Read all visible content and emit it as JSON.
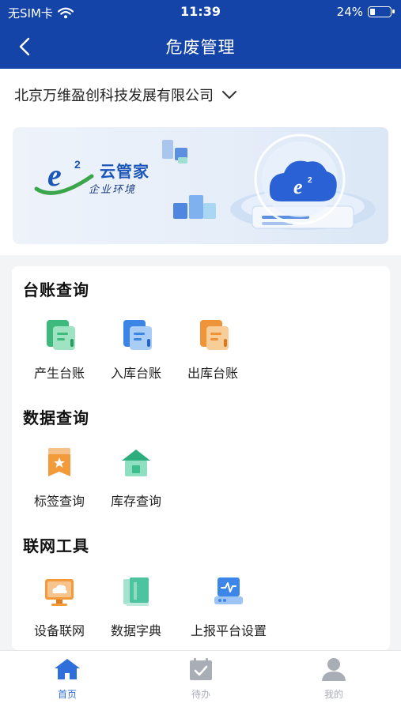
{
  "status_bar": {
    "carrier": "无SIM卡",
    "time": "11:39",
    "battery_percent_label": "24%",
    "battery_level": 0.24,
    "icons": [
      "wifi-icon",
      "battery-icon"
    ]
  },
  "nav": {
    "back_icon": "chevron-left-icon",
    "title": "危废管理"
  },
  "company": {
    "name": "北京万维盈创科技发展有限公司",
    "dropdown_icon": "chevron-down-icon"
  },
  "banner": {
    "logo_letter": "e",
    "logo_sup": "2",
    "brand": "云管家",
    "subtitle": "企业环境"
  },
  "sections": [
    {
      "title": "台账查询",
      "items": [
        {
          "label": "产生台账",
          "icon": "document-icon",
          "color": "#3dbb7f"
        },
        {
          "label": "入库台账",
          "icon": "document-icon",
          "color": "#3c85e6"
        },
        {
          "label": "出库台账",
          "icon": "document-icon",
          "color": "#f0943a"
        }
      ]
    },
    {
      "title": "数据查询",
      "items": [
        {
          "label": "标签查询",
          "icon": "tag-icon",
          "color": "#f39a3a"
        },
        {
          "label": "库存查询",
          "icon": "warehouse-icon",
          "color": "#3cbf8c"
        }
      ]
    },
    {
      "title": "联网工具",
      "items": [
        {
          "label": "设备联网",
          "icon": "cloud-monitor-icon",
          "color": "#f39a3a"
        },
        {
          "label": "数据字典",
          "icon": "book-icon",
          "color": "#4ec3a0"
        },
        {
          "label": "上报平台设置",
          "icon": "platform-settings-icon",
          "color": "#3b86e8"
        }
      ]
    }
  ],
  "tabbar": {
    "tabs": [
      {
        "label": "首页",
        "icon": "home-icon",
        "active": true
      },
      {
        "label": "待办",
        "icon": "calendar-check-icon",
        "active": false
      },
      {
        "label": "我的",
        "icon": "user-icon",
        "active": false
      }
    ],
    "active_color": "#2f6fdc",
    "inactive_color": "#a9adb5"
  },
  "colors": {
    "brand_blue": "#1544a8"
  }
}
